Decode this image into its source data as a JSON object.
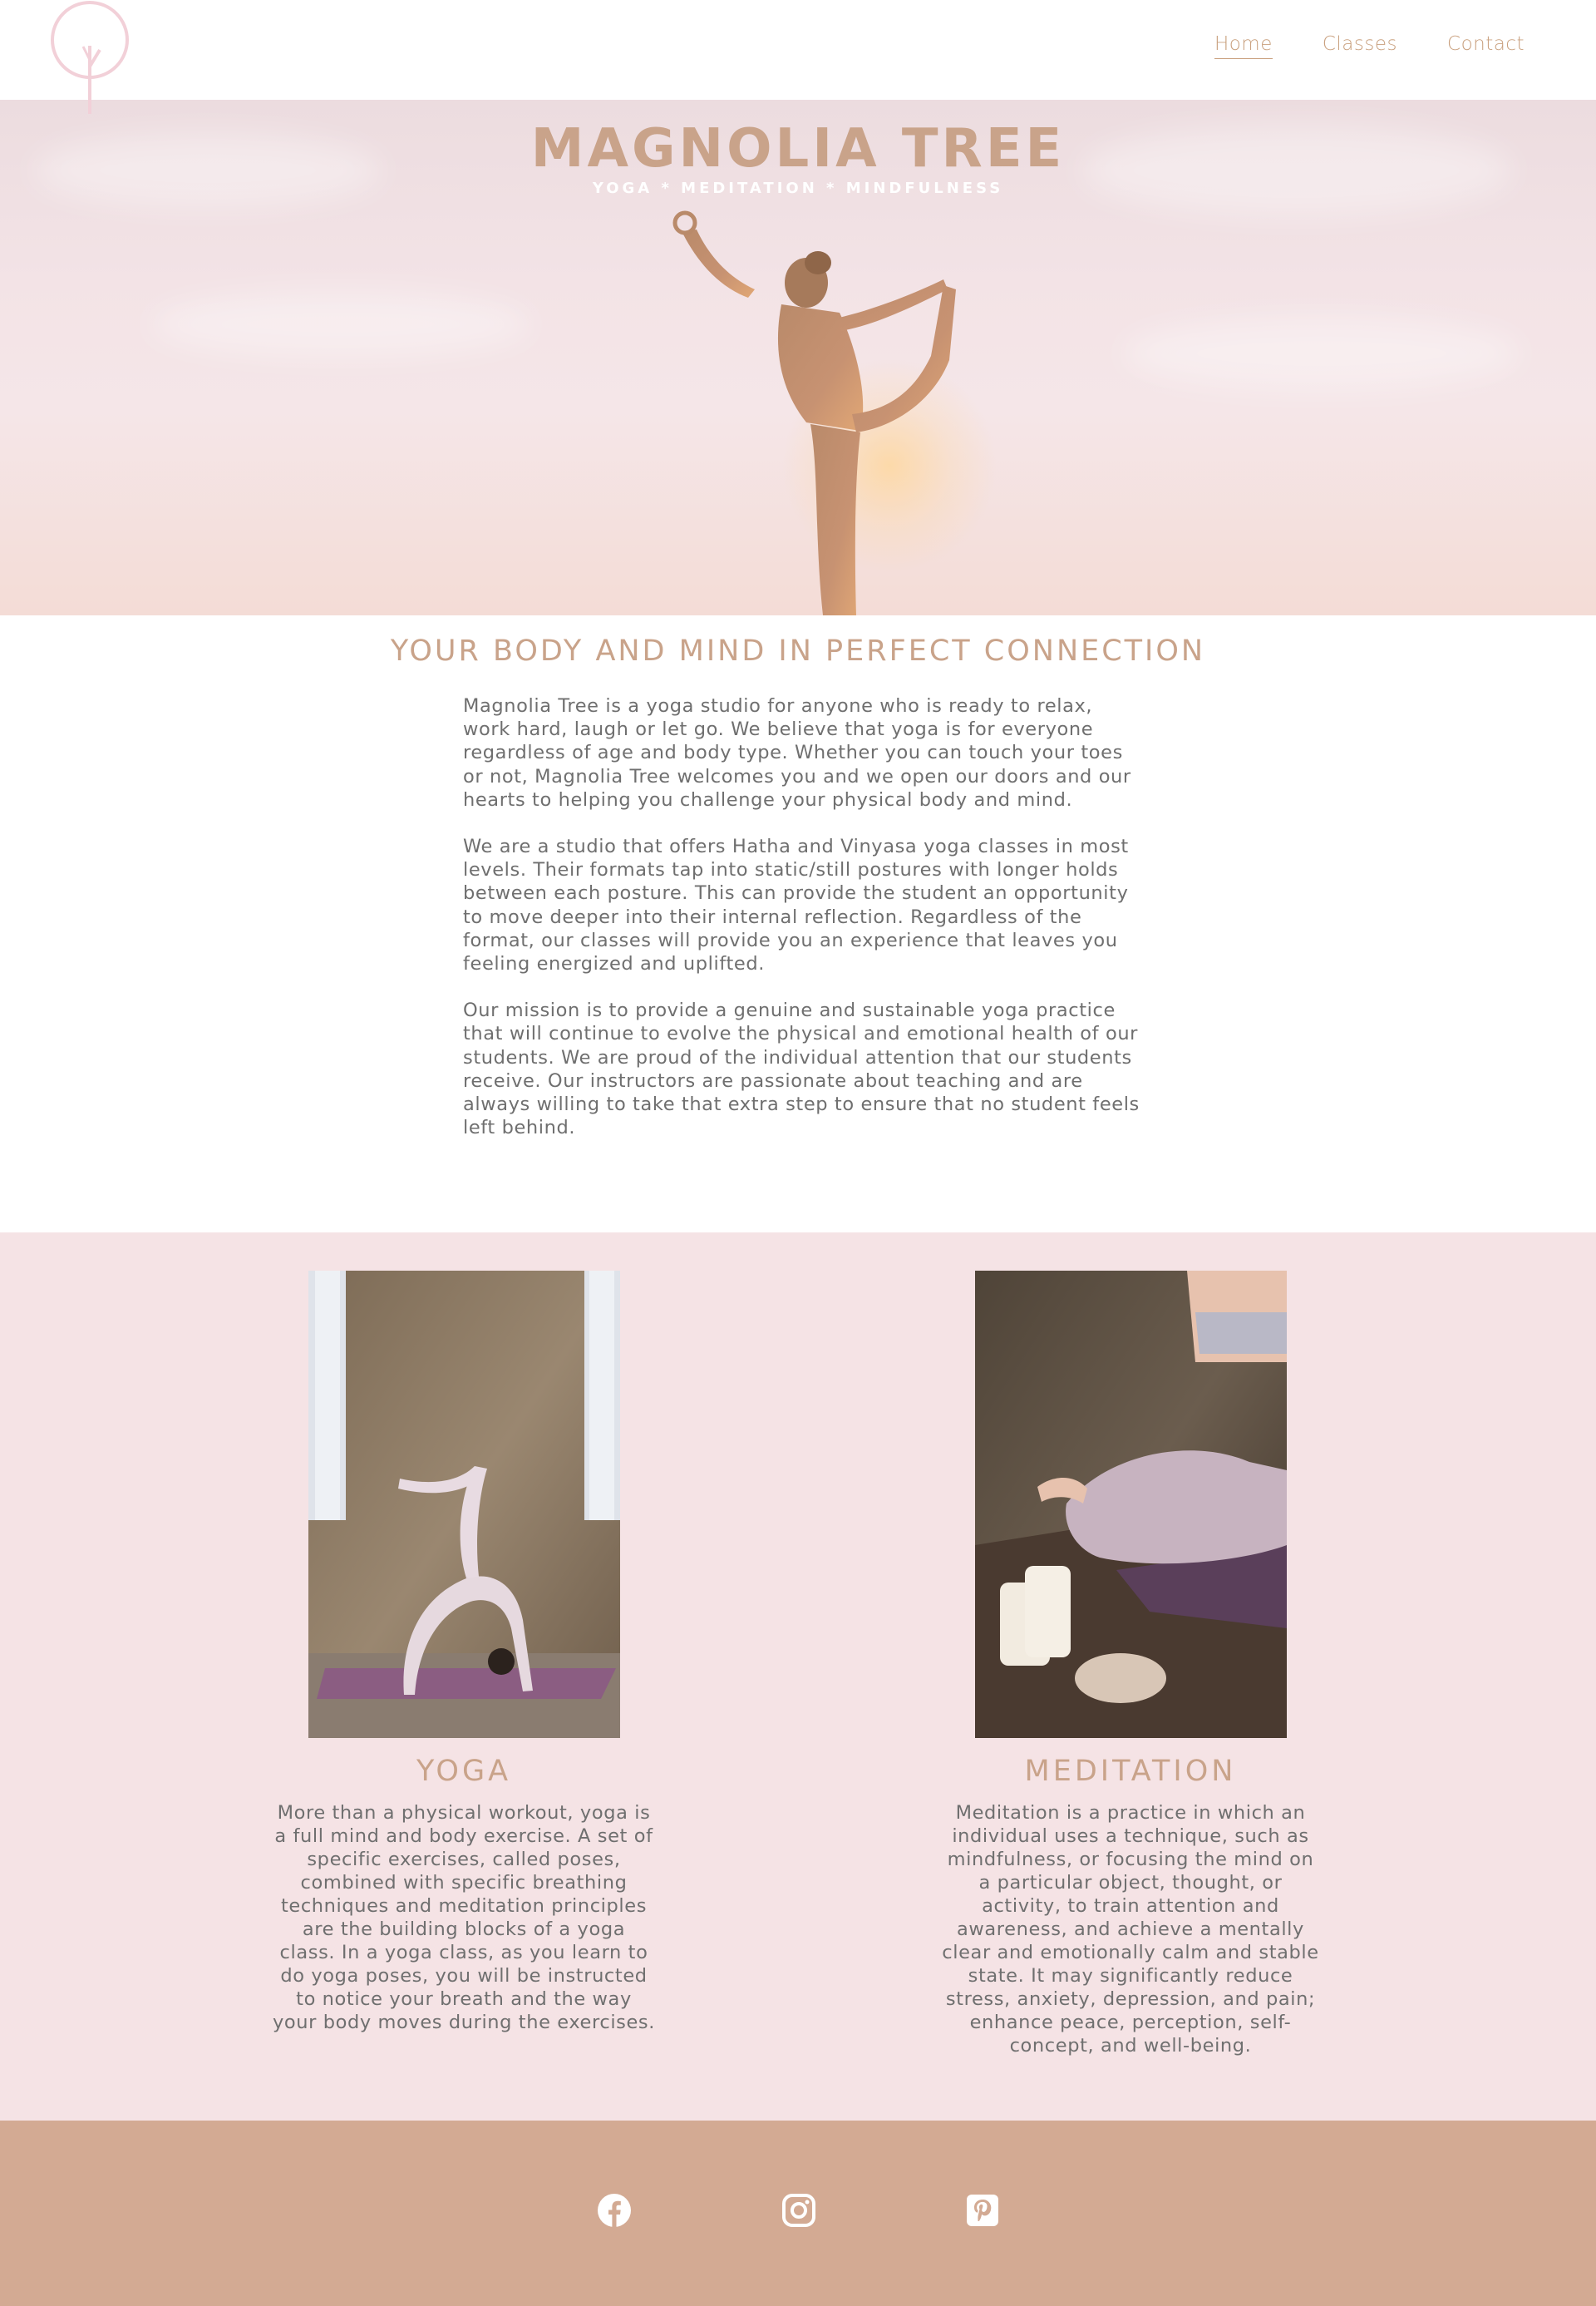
{
  "header": {
    "logo_name": "magnolia-tree-logo",
    "nav": [
      {
        "label": "Home",
        "active": true
      },
      {
        "label": "Classes",
        "active": false
      },
      {
        "label": "Contact",
        "active": false
      }
    ]
  },
  "hero": {
    "title": "MAGNOLIA TREE",
    "subtitle": "YOGA * MEDITATION * MINDFULNESS"
  },
  "intro": {
    "heading": "YOUR BODY AND MIND IN PERFECT CONNECTION",
    "paragraphs": [
      "Magnolia Tree is a yoga studio for anyone who is ready to relax, work hard, laugh or let go. We believe that yoga is for everyone regardless of age and body type. Whether you can touch your toes or not, Magnolia Tree welcomes you and we open our doors and our hearts to helping you challenge your physical body and mind.",
      "We are a studio that offers Hatha and Vinyasa yoga classes in most levels. Their formats tap into static/still postures with longer holds between each posture. This can provide the student an opportunity to move deeper into their internal reflection. Regardless of the format, our classes will provide you an experience that leaves you feeling energized and uplifted.",
      "Our mission is to provide a genuine and sustainable yoga practice that will continue to evolve the physical and emotional health of our students. We are proud of the individual attention that our students receive. Our instructors are passionate about teaching and are always willing to take that extra step to ensure that no student feels left behind."
    ]
  },
  "services": [
    {
      "title": "YOGA",
      "text": "More than a physical workout, yoga is a full mind and body exercise. A set of specific exercises, called poses, combined with specific breathing techniques and meditation principles are the building blocks of a yoga class. In a yoga class, as you learn to do yoga poses, you will be instructed to notice your breath and the way your body moves during the exercises."
    },
    {
      "title": "MEDITATION",
      "text": "Meditation is a practice in which an individual uses a technique, such as mindfulness, or focusing the mind on a particular object, thought, or activity, to train attention and awareness, and achieve a mentally clear and emotionally calm and stable state. It may significantly reduce stress, anxiety, depression, and pain; enhance peace, perception, self-concept, and well-being."
    }
  ],
  "footer": {
    "social": [
      {
        "icon": "facebook-icon"
      },
      {
        "icon": "instagram-icon"
      },
      {
        "icon": "pinterest-icon"
      }
    ]
  },
  "colors": {
    "accent": "#c9a38a",
    "nav": "#c9a07e",
    "services_bg": "#f5e3e5",
    "footer_bg": "#d3aa93",
    "logo_stroke": "#f2d0d8"
  }
}
